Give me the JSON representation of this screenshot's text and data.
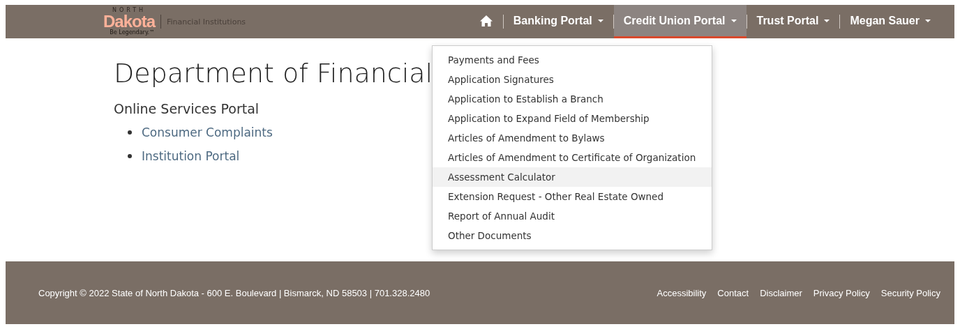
{
  "logo": {
    "top": "NORTH",
    "name": "Dakota",
    "tagline": "Be Legendary.™",
    "agency": "Financial Institutions"
  },
  "nav": [
    {
      "kind": "home",
      "selected": false
    },
    {
      "kind": "menu",
      "label": "Banking Portal",
      "selected": false
    },
    {
      "kind": "menu",
      "label": "Credit Union Portal",
      "selected": true
    },
    {
      "kind": "menu",
      "label": "Trust Portal",
      "selected": false
    },
    {
      "kind": "menu",
      "label": "Megan Sauer",
      "selected": false
    }
  ],
  "dropdown": [
    {
      "label": "Payments and Fees",
      "highlighted": false
    },
    {
      "label": "Application Signatures",
      "highlighted": false
    },
    {
      "label": "Application to Establish a Branch",
      "highlighted": false
    },
    {
      "label": "Application to Expand Field of Membership",
      "highlighted": false
    },
    {
      "label": "Articles of Amendment to Bylaws",
      "highlighted": false
    },
    {
      "label": "Articles of Amendment to Certificate of Organization",
      "highlighted": false
    },
    {
      "label": "Assessment Calculator",
      "highlighted": true
    },
    {
      "label": "Extension Request - Other Real Estate Owned",
      "highlighted": false
    },
    {
      "label": "Report of Annual Audit",
      "highlighted": false
    },
    {
      "label": "Other Documents",
      "highlighted": false
    }
  ],
  "main": {
    "title": "Department of Financial",
    "subtitle": "Online Services Portal",
    "links": [
      "Consumer Complaints",
      "Institution Portal"
    ]
  },
  "footer": {
    "copyright": "Copyright © 2022 State of North Dakota - 600 E. Boulevard | Bismarck, ND 58503 | 701.328.2480",
    "links": [
      "Accessibility",
      "Contact",
      "Disclaimer",
      "Privacy Policy",
      "Security Policy"
    ]
  }
}
